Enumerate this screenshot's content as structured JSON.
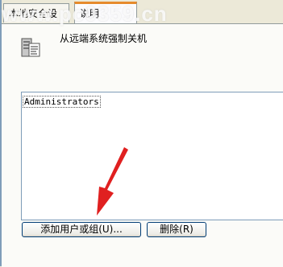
{
  "tabs": [
    {
      "label": "本地安全设置"
    },
    {
      "label": "说明"
    }
  ],
  "watermark": "www.pc0359.cn",
  "policy": {
    "title": "从远端系统强制关机",
    "icon": "server-policy-icon"
  },
  "list": {
    "items": [
      {
        "label": "Administrators"
      }
    ]
  },
  "buttons": {
    "add_label": "添加用户或组(U)...",
    "remove_label": "删除(R)"
  },
  "colors": {
    "annotation_arrow": "#e02020",
    "tab_highlight": "#e68b2c"
  }
}
